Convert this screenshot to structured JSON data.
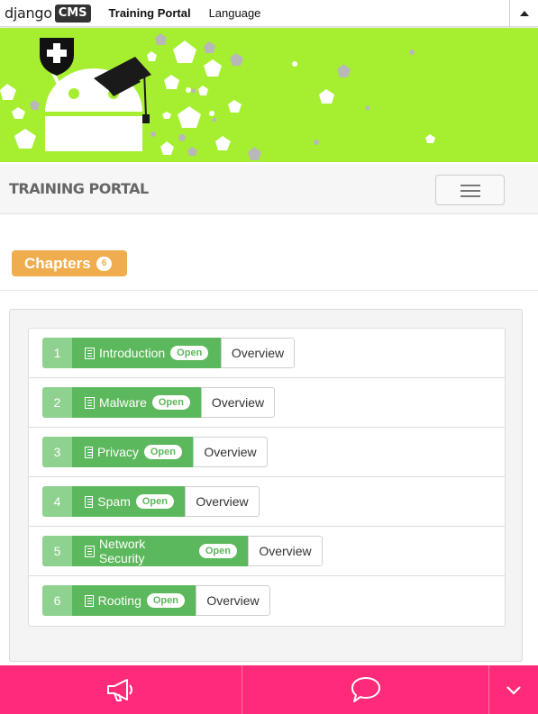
{
  "toolbar": {
    "logo_text": "django",
    "logo_badge": "CMS",
    "menu": [
      "Training Portal",
      "Language"
    ],
    "collapse_icon": "caret-up-icon"
  },
  "banner": {
    "background": "#a6ef30",
    "illustration": "android-robot-with-graduation-cap-and-shield"
  },
  "navbar": {
    "brand": "TRAINING PORTAL",
    "toggle_icon": "hamburger-icon"
  },
  "chapters": {
    "label": "Chapters",
    "count": "6",
    "color": "#f0ad4e"
  },
  "chapter_list": [
    {
      "num": "1",
      "title": "Introduction",
      "status": "Open",
      "action": "Overview"
    },
    {
      "num": "2",
      "title": "Malware",
      "status": "Open",
      "action": "Overview"
    },
    {
      "num": "3",
      "title": "Privacy",
      "status": "Open",
      "action": "Overview"
    },
    {
      "num": "4",
      "title": "Spam",
      "status": "Open",
      "action": "Overview"
    },
    {
      "num": "5",
      "title": "Network Security",
      "status": "Open",
      "action": "Overview"
    },
    {
      "num": "6",
      "title": "Rooting",
      "status": "Open",
      "action": "Overview"
    }
  ],
  "bottom_bar": {
    "color": "#ff2a79",
    "icons": [
      "megaphone-icon",
      "chat-bubble-icon",
      "chevron-down-icon"
    ]
  }
}
